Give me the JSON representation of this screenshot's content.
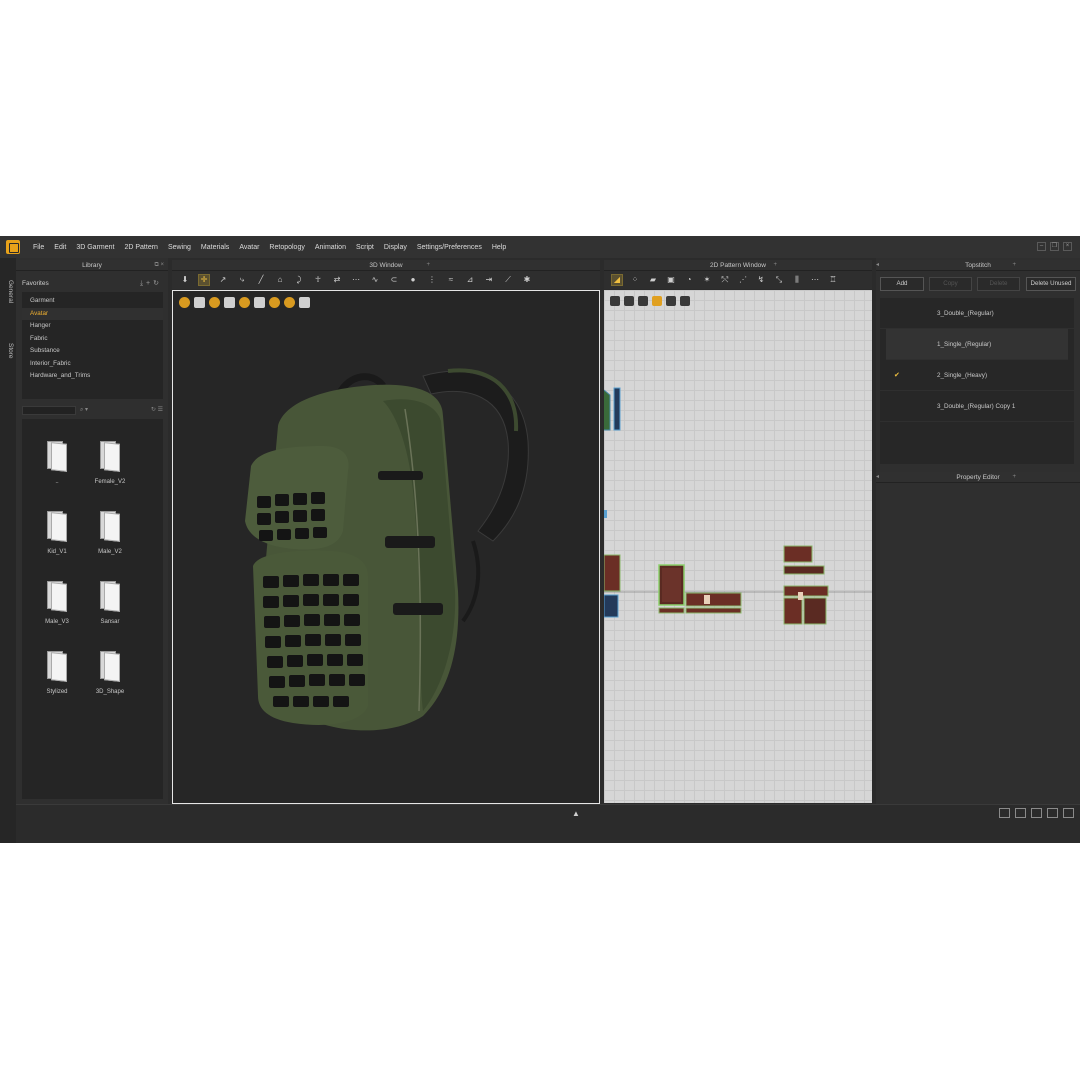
{
  "menu": [
    "File",
    "Edit",
    "3D Garment",
    "2D Pattern",
    "Sewing",
    "Materials",
    "Avatar",
    "Retopology",
    "Animation",
    "Script",
    "Display",
    "Settings/Preferences",
    "Help"
  ],
  "vertical_tabs": [
    "General",
    "Store"
  ],
  "library": {
    "title": "Library",
    "favorites_label": "Favorites",
    "favorites": [
      "Garment",
      "Avatar",
      "Hanger",
      "Fabric",
      "Substance",
      "Interior_Fabric",
      "Hardware_and_Trims"
    ],
    "selected_favorite": "Avatar",
    "items": [
      "..",
      "Female_V2",
      "Kid_V1",
      "Male_V2",
      "Male_V3",
      "Sansar",
      "Stylized",
      "3D_Shape"
    ]
  },
  "window3d": {
    "title": "3D Window"
  },
  "window2d": {
    "title": "2D Pattern Window"
  },
  "topstitch": {
    "title": "Topstitch",
    "buttons": {
      "add": "Add",
      "copy": "Copy",
      "delete": "Delete",
      "delete_unused": "Delete Unused"
    },
    "items": [
      {
        "name": "3_Double_(Regular)",
        "checked": false,
        "selected": false
      },
      {
        "name": "1_Single_(Regular)",
        "checked": false,
        "selected": true
      },
      {
        "name": "2_Single_(Heavy)",
        "checked": true,
        "selected": false
      },
      {
        "name": "3_Double_(Regular) Copy 1",
        "checked": false,
        "selected": false
      }
    ]
  },
  "property_editor": {
    "title": "Property Editor"
  },
  "colors": {
    "accent": "#e8a21a",
    "fabric": "#4a5a3a",
    "pattern_wood": "#6b2e25",
    "pattern_green": "#8bb86a"
  }
}
